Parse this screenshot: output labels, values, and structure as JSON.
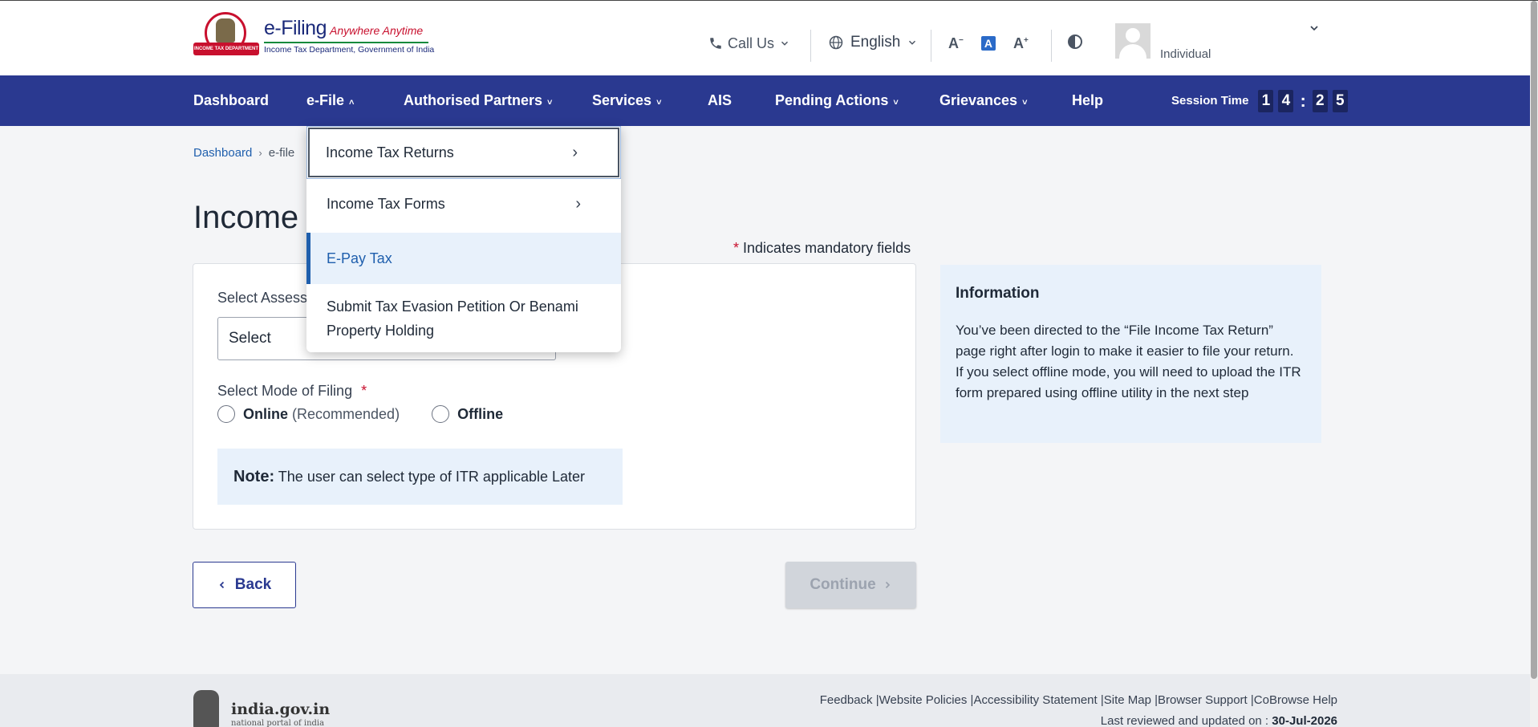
{
  "header": {
    "logo": {
      "title": "e-Filing",
      "tagline": "Anywhere Anytime",
      "dept": "Income Tax Department, Government of India",
      "emblem_text": "INCOME TAX DEPARTMENT"
    },
    "call_us": "Call Us",
    "language": "English",
    "font_decrease": "A",
    "font_normal": "A",
    "font_increase": "A",
    "user_type": "Individual"
  },
  "nav": {
    "items": [
      {
        "label": "Dashboard"
      },
      {
        "label": "e-File"
      },
      {
        "label": "Authorised Partners"
      },
      {
        "label": "Services"
      },
      {
        "label": "AIS"
      },
      {
        "label": "Pending Actions"
      },
      {
        "label": "Grievances"
      },
      {
        "label": "Help"
      }
    ],
    "session_label": "Session Time",
    "session_digits": [
      "1",
      "4",
      "2",
      "5"
    ]
  },
  "breadcrumb": {
    "home": "Dashboard",
    "current": "e-file"
  },
  "page": {
    "title": "Income Tax Return",
    "mandatory_note": "Indicates mandatory fields",
    "assessment_label": "Select Assessment Year",
    "assessment_value": "Select",
    "mode_label": "Select Mode of Filing",
    "online_label": "Online",
    "online_sub": "(Recommended)",
    "offline_label": "Offline",
    "note_bold": "Note:",
    "note_text": "The user can select type of ITR applicable Later",
    "back": "Back",
    "continue": "Continue"
  },
  "info": {
    "title": "Information",
    "text": "You’ve been directed to the “File Income Tax Return” page right after login to make it easier to file your return.\nIf you select offline mode, you will need to upload the ITR form prepared using offline utility in the next step"
  },
  "dropdown": {
    "items": [
      {
        "label": "Income Tax Returns"
      },
      {
        "label": "Income Tax Forms"
      },
      {
        "label": "E-Pay Tax"
      },
      {
        "label": "Submit Tax Evasion Petition Or Benami Property Holding"
      }
    ]
  },
  "footer": {
    "gov_name": "india.gov.in",
    "gov_sub": "national portal of india",
    "links": "Feedback |Website Policies |Accessibility Statement |Site Map |Browser Support |CoBrowse Help",
    "updated_label": "Last reviewed and updated on :",
    "updated_date": "30-Jul-2026"
  },
  "colors": {
    "nav_bg": "#2a3990",
    "accent": "#1f5fad",
    "required": "#c8102e"
  }
}
